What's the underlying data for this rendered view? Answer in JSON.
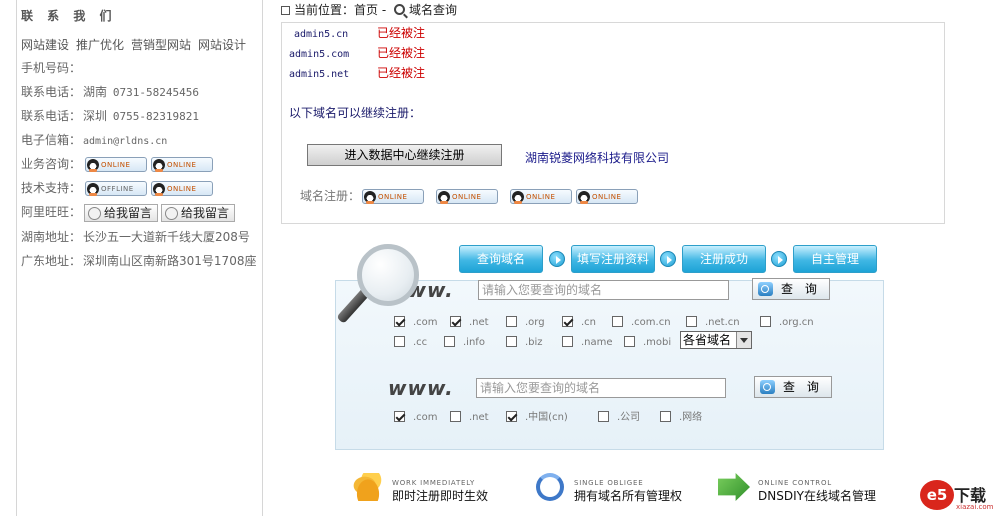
{
  "sidebar": {
    "title": "联 系 我 们",
    "services": [
      "网站建设",
      "推广优化",
      "营销型网站",
      "网站设计"
    ],
    "mobile_label": "手机号码：",
    "phone_hunan": {
      "label": "联系电话：",
      "region": "湖南",
      "number": "0731-58245456"
    },
    "phone_shenzhen": {
      "label": "联系电话：",
      "region": "深圳",
      "number": "0755-82319821"
    },
    "email": {
      "label": "电子信箱：",
      "value": "admin@rldns.cn"
    },
    "consult": {
      "label": "业务咨询：",
      "badges": [
        "ONLINE",
        "ONLINE"
      ]
    },
    "support": {
      "label": "技术支持：",
      "badges": [
        "OFFLINE",
        "ONLINE"
      ]
    },
    "aliwangwang": {
      "label": "阿里旺旺：",
      "buttons": [
        "给我留言",
        "给我留言"
      ]
    },
    "hunan_address": {
      "label": "湖南地址：",
      "value": "长沙五一大道新千线大厦208号"
    },
    "guangdong_address": {
      "label": "广东地址：",
      "value": "深圳南山区南新路301号1708座"
    }
  },
  "breadcrumb": {
    "prefix": "当前位置：",
    "home": "首页",
    "sep": "-",
    "current": "域名查询"
  },
  "results": [
    {
      "domain": "admin5.cn",
      "status": "已经被注"
    },
    {
      "domain": "admin5.com",
      "status": "已经被注"
    },
    {
      "domain": "admin5.net",
      "status": "已经被注"
    }
  ],
  "more_label": "以下域名可以继续注册：",
  "continue_button": "进入数据中心继续注册",
  "company": "湖南锐菱网络科技有限公司",
  "domain_reg": {
    "label": "域名注册：",
    "badges": [
      "ONLINE",
      "ONLINE",
      "ONLINE",
      "ONLINE"
    ]
  },
  "steps": [
    "查询域名",
    "填写注册资料",
    "注册成功",
    "自主管理"
  ],
  "search1": {
    "prefix": "www.",
    "placeholder": "请输入您要查询的域名",
    "button": "查 询",
    "tlds_row1": [
      {
        "name": ".com",
        "checked": true
      },
      {
        "name": ".net",
        "checked": true
      },
      {
        "name": ".org",
        "checked": false
      },
      {
        "name": ".cn",
        "checked": true
      },
      {
        "name": ".com.cn",
        "checked": false
      },
      {
        "name": ".net.cn",
        "checked": false
      },
      {
        "name": ".org.cn",
        "checked": false
      }
    ],
    "tlds_row2": [
      {
        "name": ".cc",
        "checked": false
      },
      {
        "name": ".info",
        "checked": false
      },
      {
        "name": ".biz",
        "checked": false
      },
      {
        "name": ".name",
        "checked": false
      },
      {
        "name": ".mobi",
        "checked": false
      }
    ],
    "province_select": "各省域名"
  },
  "search2": {
    "prefix": "www.",
    "placeholder": "请输入您要查询的域名",
    "button": "查 询",
    "tlds": [
      {
        "name": ".com",
        "checked": true
      },
      {
        "name": ".net",
        "checked": false
      },
      {
        "name": ".中国(cn)",
        "checked": true
      },
      {
        "name": ".公司",
        "checked": false
      },
      {
        "name": ".网络",
        "checked": false
      }
    ]
  },
  "features": [
    {
      "en": "WORK IMMEDIATELY",
      "cn": "即时注册即时生效",
      "icon": "coins-icon"
    },
    {
      "en": "SINGLE OBLIGEE",
      "cn": "拥有域名所有管理权",
      "icon": "recycle-icon"
    },
    {
      "en": "ONLINE CONTROL",
      "cn": "DNSDIY在线域名管理",
      "icon": "arrow-icon"
    }
  ],
  "watermark": {
    "logo": "e5",
    "text": "下载",
    "url": "xiazai.com"
  }
}
